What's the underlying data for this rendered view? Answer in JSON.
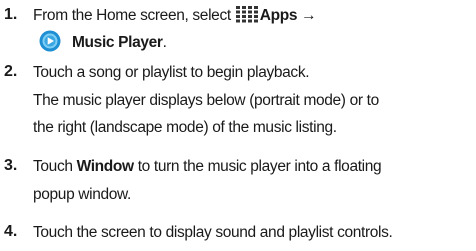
{
  "cut_line": "top edge",
  "steps": [
    {
      "number": "1.",
      "line1_before": "From the Home screen, select ",
      "apps_label": "Apps →",
      "music_label": "Music Player",
      "music_after": "."
    },
    {
      "number": "2.",
      "line1": "Touch a song or playlist to begin playback.",
      "line2": "The music player displays below (portrait mode) or to",
      "line3": "the right (landscape mode) of the music listing."
    },
    {
      "number": "3.",
      "line1_before": "Touch ",
      "window_label": "Window",
      "line1_after": " to turn the music player into a floating",
      "line2": "popup window."
    },
    {
      "number": "4.",
      "line1": "Touch the screen to display sound and playlist controls."
    }
  ],
  "icons": {
    "apps": "apps-grid-icon",
    "music_player": "music-player-icon"
  },
  "colors": {
    "text": "#1a1a1a",
    "apps_grid": "#333333",
    "player_outer": "#1f8fd3",
    "player_inner": "#7fd0f5"
  }
}
